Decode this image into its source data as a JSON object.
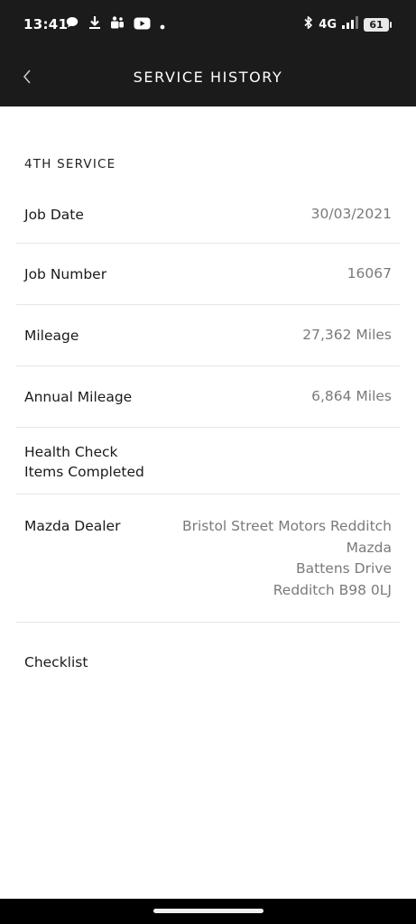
{
  "status_bar": {
    "time": "13:41",
    "network": "4G",
    "battery": "61",
    "left_icons": [
      "chat-bubble-icon",
      "download-icon",
      "teams-icon",
      "youtube-icon",
      "dot-icon"
    ],
    "right_icons": [
      "bluetooth-icon",
      "signal-icon",
      "battery-icon"
    ]
  },
  "header": {
    "title": "SERVICE HISTORY",
    "back_icon": "chevron-left-icon",
    "background": "#1b1b1b"
  },
  "service": {
    "heading": "4TH SERVICE",
    "rows": [
      {
        "label": "Job Date",
        "value": "30/03/2021"
      },
      {
        "label": "Job Number",
        "value": "16067"
      },
      {
        "label": "Mileage",
        "value": "27,362 Miles"
      },
      {
        "label": "Annual Mileage",
        "value": "6,864 Miles"
      },
      {
        "label_line1": "Health Check",
        "label_line2": "Items Completed"
      },
      {
        "label": "Mazda Dealer",
        "value_lines": [
          "Bristol Street Motors Redditch",
          "Mazda",
          "Battens Drive",
          "Redditch B98 0LJ"
        ]
      },
      {
        "label": "Checklist"
      }
    ]
  }
}
